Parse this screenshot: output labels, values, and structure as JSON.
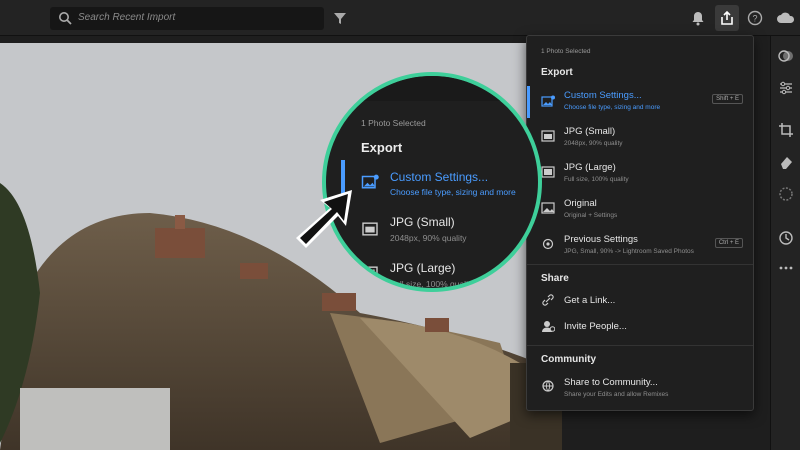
{
  "topbar": {
    "search_placeholder": "Search Recent Import",
    "icons": [
      "search-icon",
      "filter-icon",
      "notification-icon",
      "share-icon",
      "help-icon",
      "cloud-icon"
    ]
  },
  "menu": {
    "selection": "1 Photo Selected",
    "export_heading": "Export",
    "items": [
      {
        "title": "Custom Settings...",
        "subtitle": "Choose file type, sizing and more",
        "shortcut": "Shift + E",
        "active": true
      },
      {
        "title": "JPG (Small)",
        "subtitle": "2048px, 90% quality",
        "shortcut": ""
      },
      {
        "title": "JPG (Large)",
        "subtitle": "Full size, 100% quality",
        "shortcut": ""
      },
      {
        "title": "Original",
        "subtitle": "Original + Settings",
        "shortcut": ""
      },
      {
        "title": "Previous Settings",
        "subtitle": "JPG, Small, 90% -> Lightroom Saved Photos",
        "shortcut": "Ctrl + E"
      }
    ],
    "share_heading": "Share",
    "share_items": [
      "Get a Link...",
      "Invite People..."
    ],
    "community_heading": "Community",
    "community_item": {
      "title": "Share to Community...",
      "subtitle": "Share your Edits and allow Remixes"
    }
  },
  "zoom": {
    "selection": "1 Photo Selected",
    "export_heading": "Export",
    "custom_title": "Custom Settings...",
    "custom_subtitle": "Choose file type, sizing and more",
    "small_title": "JPG (Small)",
    "small_subtitle": "2048px, 90% quality",
    "large_title": "JPG (Large)",
    "large_subtitle": "Full size, 100% quality"
  },
  "colors": {
    "accent": "#4a9cff",
    "ring": "#3ecf9a",
    "menu_bg": "#1f1f1f"
  }
}
